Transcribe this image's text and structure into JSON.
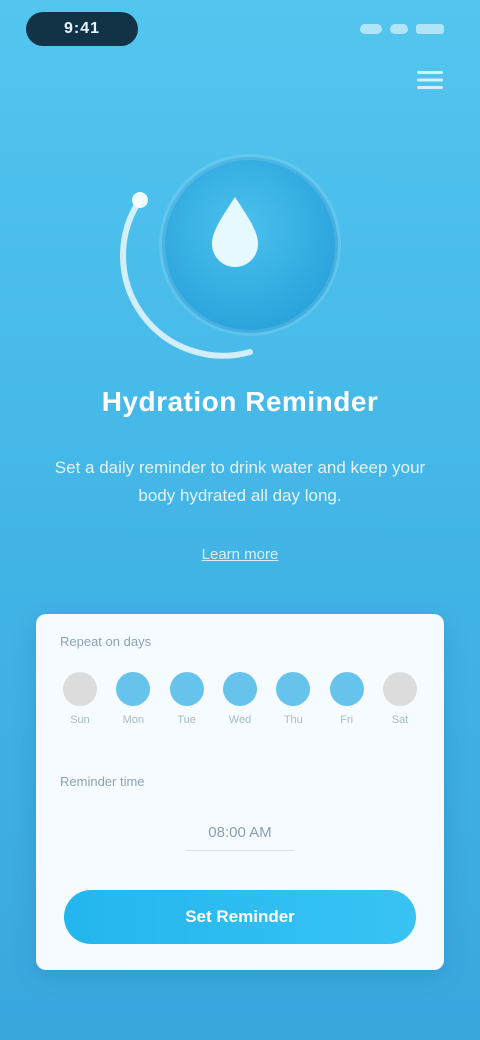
{
  "status_bar": {
    "time": "9:41"
  },
  "hero": {
    "icon": "water-drop-icon"
  },
  "text": {
    "title": "Hydration Reminder",
    "description": "Set a daily reminder to drink water and keep your body hydrated all day long.",
    "learn_more": "Learn more"
  },
  "card": {
    "days_label": "Repeat on days",
    "days": [
      {
        "name": "Sun",
        "active": false
      },
      {
        "name": "Mon",
        "active": true
      },
      {
        "name": "Tue",
        "active": true
      },
      {
        "name": "Wed",
        "active": true
      },
      {
        "name": "Thu",
        "active": true
      },
      {
        "name": "Fri",
        "active": true
      },
      {
        "name": "Sat",
        "active": false
      }
    ],
    "time_label": "Reminder time",
    "time_value": "08:00 AM",
    "button_label": "Set Reminder"
  },
  "colors": {
    "background_top": "#52c6ef",
    "background_bottom": "#3aa7df",
    "active_day": "#66c3ec",
    "inactive_day": "#dcdcdc",
    "button": "#2cbcf1"
  }
}
